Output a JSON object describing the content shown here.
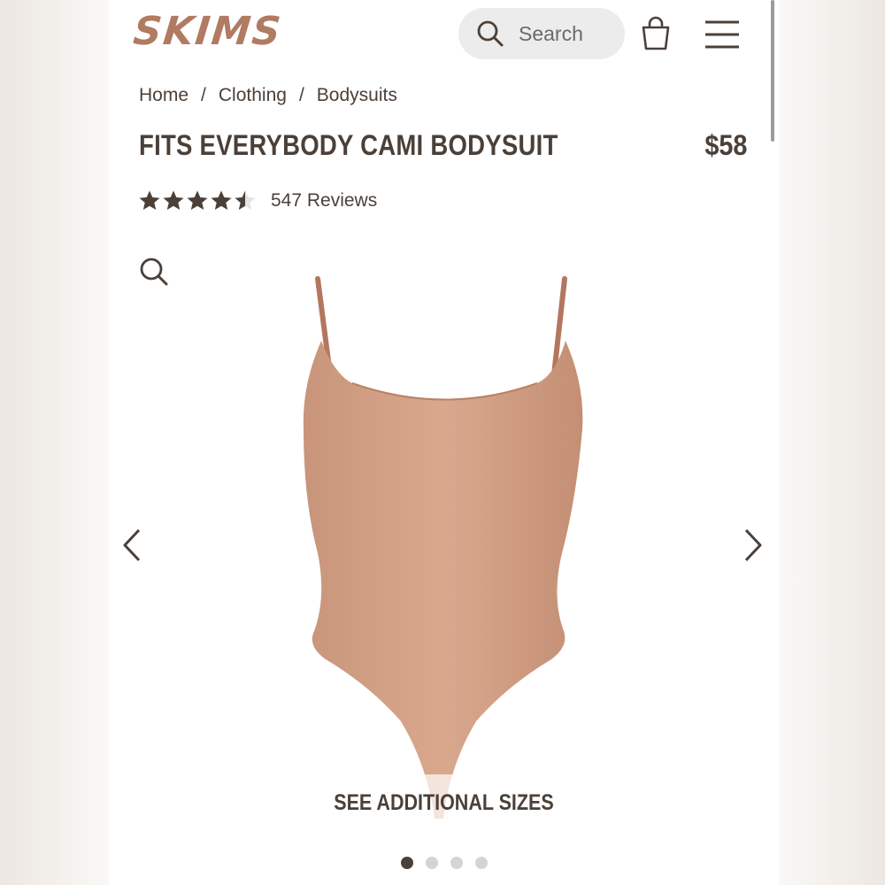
{
  "header": {
    "logo_text": "SKIMS",
    "search_label": "Search",
    "icons": [
      "search-icon",
      "shopping-bag-icon",
      "menu-icon"
    ]
  },
  "breadcrumb": [
    "Home",
    "Clothing",
    "Bodysuits"
  ],
  "breadcrumb_separator": "/",
  "product": {
    "title": "FITS EVERYBODY CAMI BODYSUIT",
    "price": "$58",
    "rating": 4.5,
    "rating_max": 5,
    "reviews_label": "547 Reviews"
  },
  "gallery": {
    "see_sizes_label": "SEE ADDITIONAL SIZES",
    "slide_count": 4,
    "active_slide": 1
  },
  "colors": {
    "text": "#4b4038",
    "brand": "#b07b62",
    "product": "#d3a085"
  }
}
